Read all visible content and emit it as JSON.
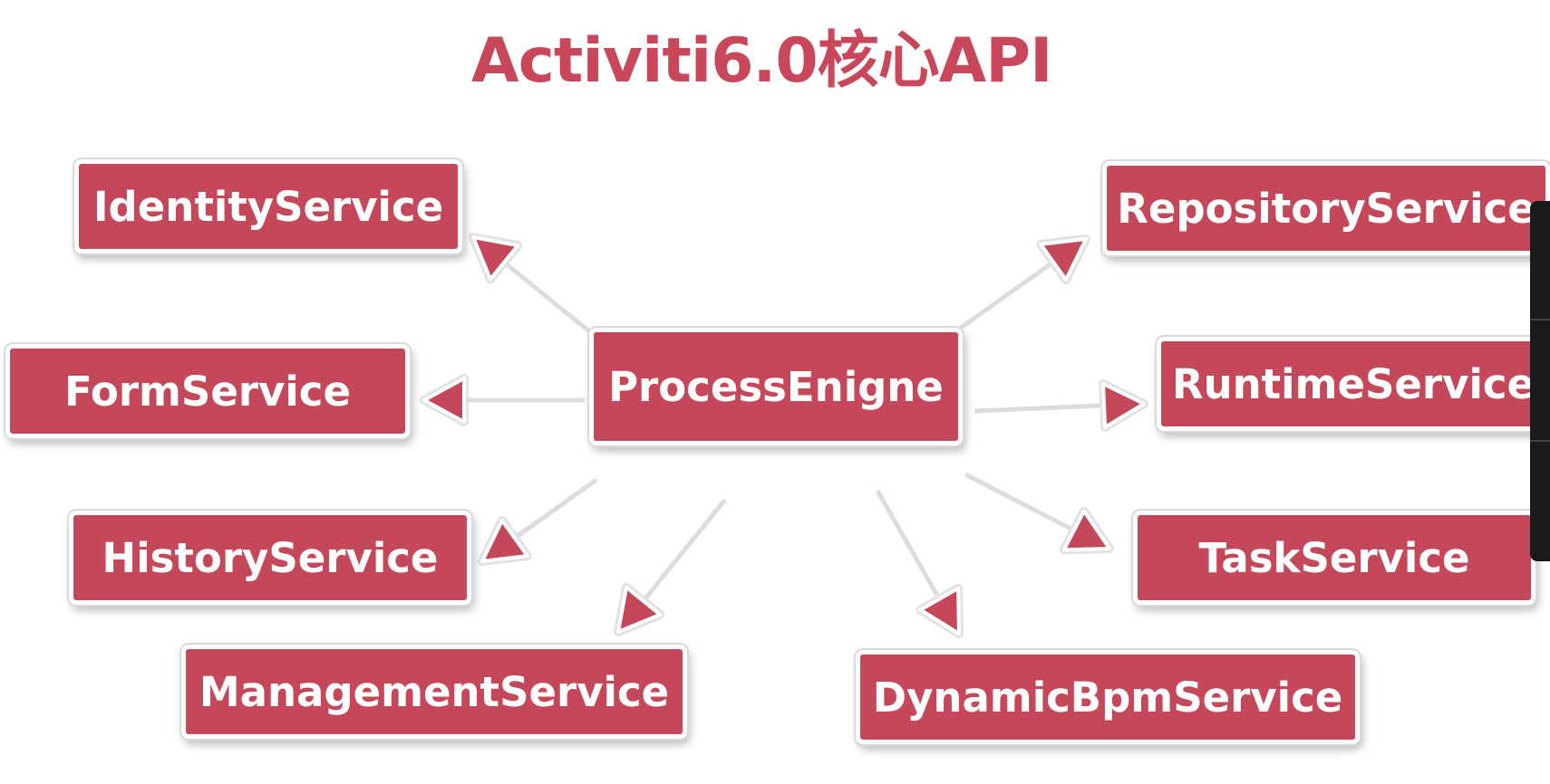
{
  "title": "Activiti6.0核心API",
  "colors": {
    "accent": "#c4485a",
    "title": "#c8475a",
    "arrow": "#c4485a",
    "line": "#dcdcdc"
  },
  "center": {
    "label": "ProcessEnigne"
  },
  "services": [
    {
      "id": "identity",
      "label": "IdentityService"
    },
    {
      "id": "form",
      "label": "FormService"
    },
    {
      "id": "history",
      "label": "HistoryService"
    },
    {
      "id": "management",
      "label": "ManagementService"
    },
    {
      "id": "repository",
      "label": "RepositoryService"
    },
    {
      "id": "runtime",
      "label": "RuntimeService"
    },
    {
      "id": "task",
      "label": "TaskService"
    },
    {
      "id": "dynamicbpm",
      "label": "DynamicBpmService"
    }
  ]
}
